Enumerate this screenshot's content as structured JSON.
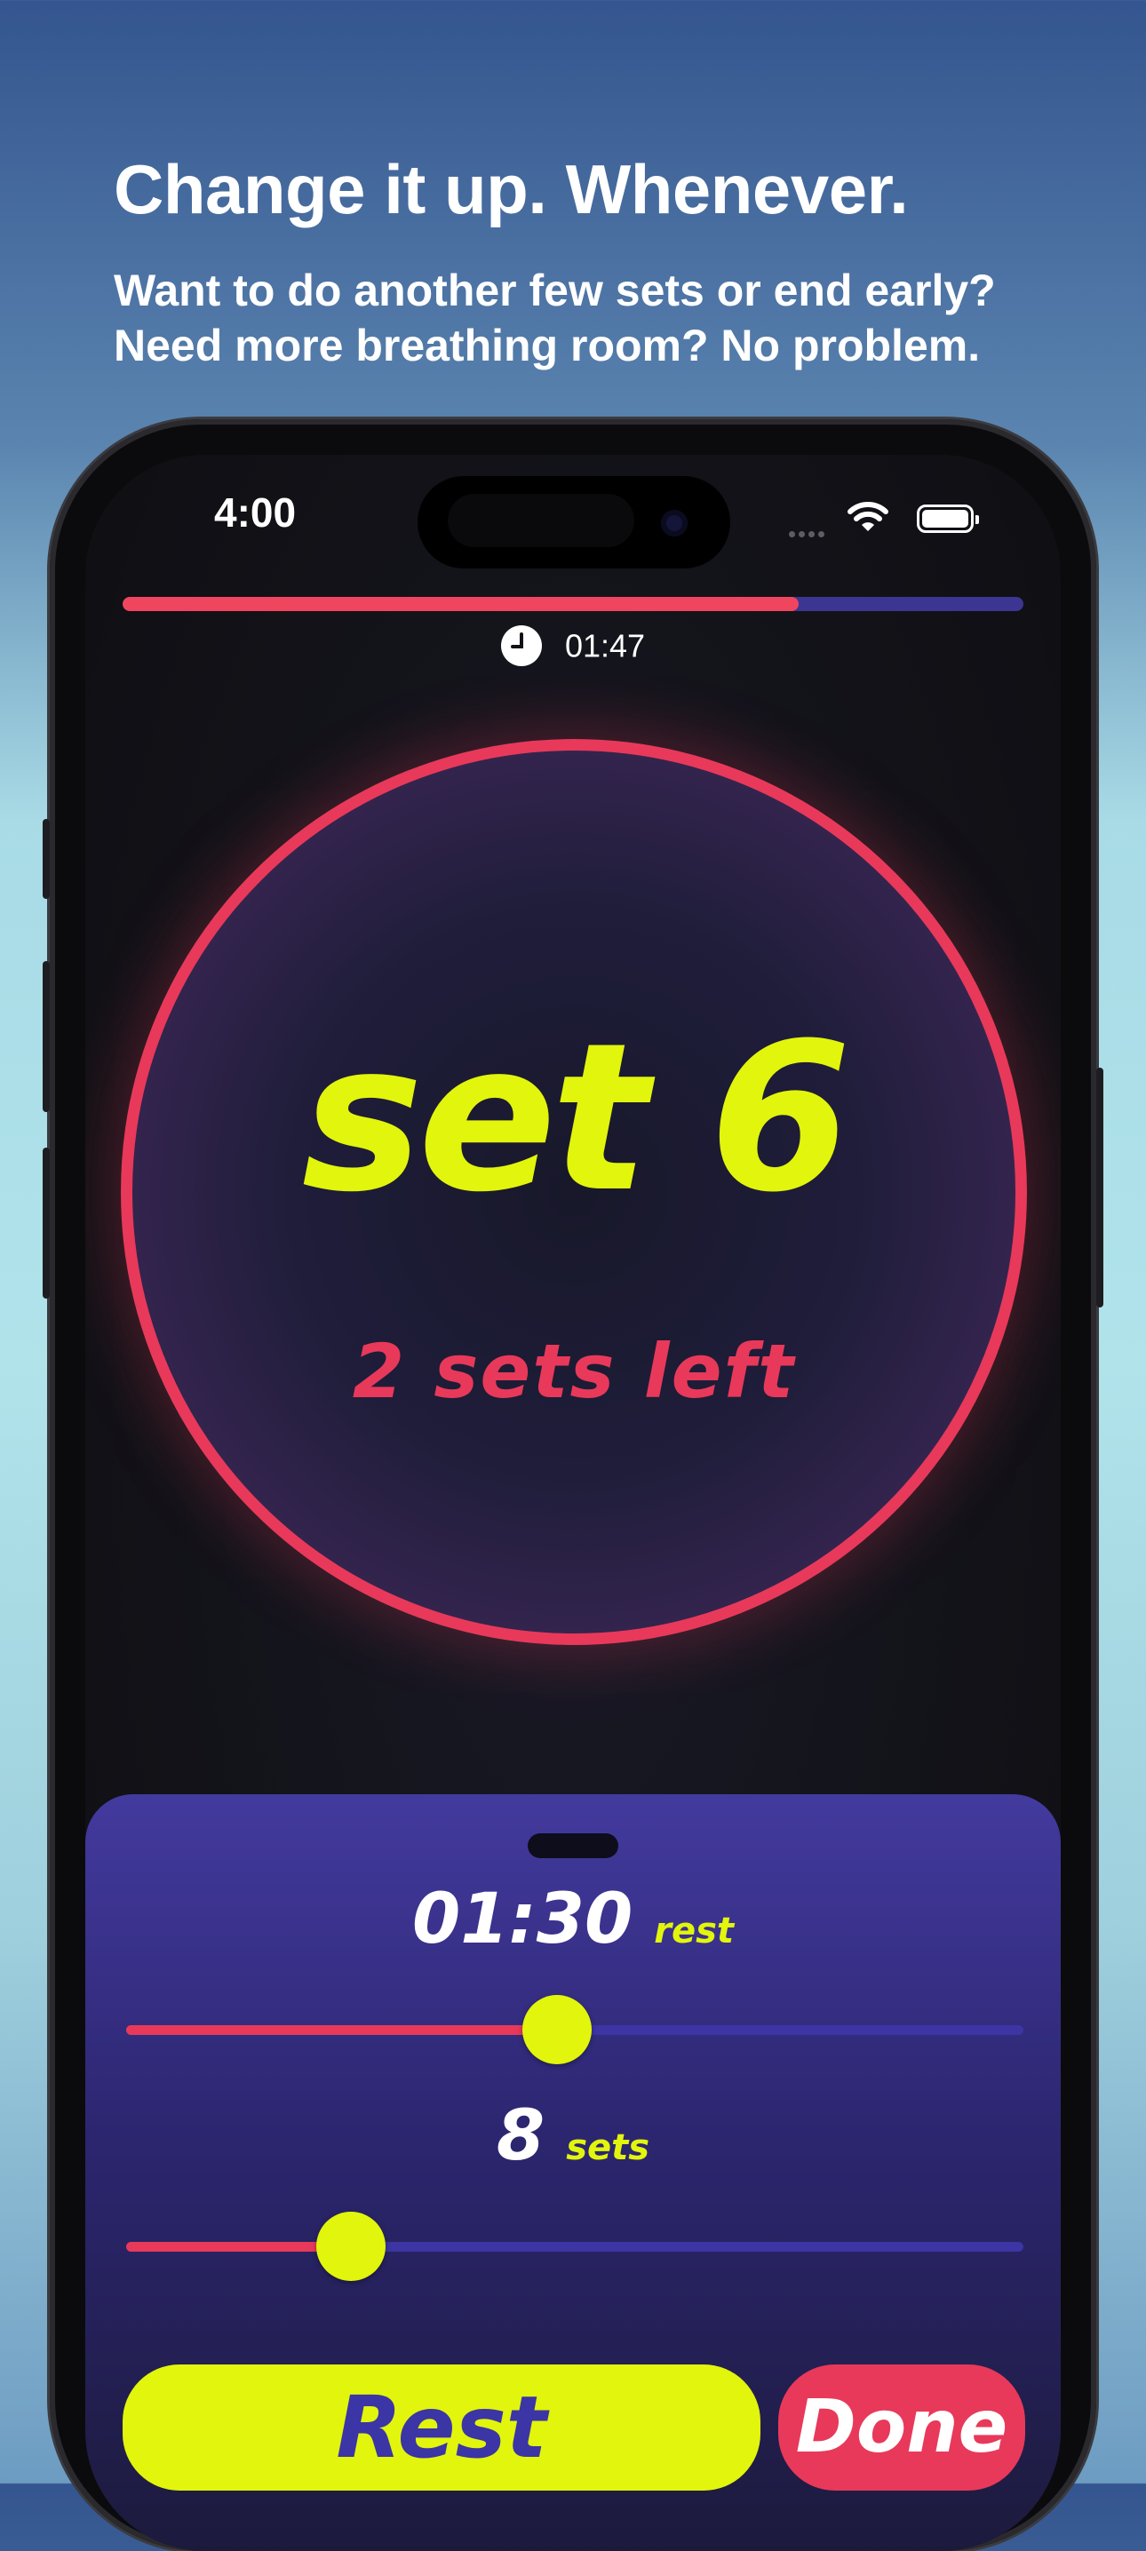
{
  "marketing": {
    "headline": "Change it up. Whenever.",
    "subline": "Want to do another few sets or end early? Need more breathing room? No problem."
  },
  "status_bar": {
    "time": "4:00",
    "icons": [
      "cellular-signal-icon",
      "wifi-icon",
      "battery-icon"
    ]
  },
  "workout": {
    "progress_fraction": 0.75,
    "elapsed": "01:47",
    "current_set_label": "set 6",
    "sets_left_label": "2 sets left"
  },
  "controls": {
    "rest_value": "01:30",
    "rest_unit": "rest",
    "rest_slider_fraction": 0.48,
    "sets_value": "8",
    "sets_unit": "sets",
    "sets_slider_fraction": 0.25,
    "rest_button": "Rest",
    "done_button": "Done"
  },
  "colors": {
    "accent_yellow": "#e2f50c",
    "accent_red": "#e8395a",
    "accent_indigo": "#3c35a3"
  }
}
